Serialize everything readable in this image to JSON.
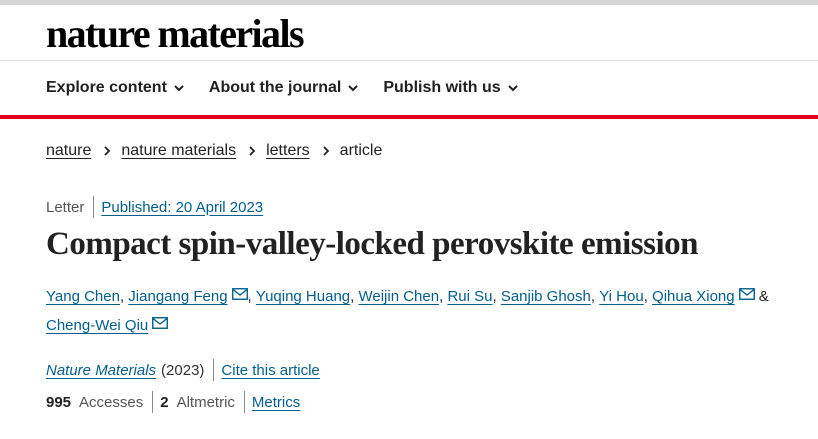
{
  "site": {
    "logo_text": "nature materials"
  },
  "nav": {
    "items": [
      {
        "label": "Explore content"
      },
      {
        "label": "About the journal"
      },
      {
        "label": "Publish with us"
      }
    ]
  },
  "breadcrumb": {
    "items": [
      "nature",
      "nature materials",
      "letters"
    ],
    "current": "article"
  },
  "article": {
    "type": "Letter",
    "published": "Published: 20 April 2023",
    "title": "Compact spin-valley-locked perovskite emission",
    "authors": [
      {
        "name": "Yang Chen",
        "email": false
      },
      {
        "name": "Jiangang Feng",
        "email": true
      },
      {
        "name": "Yuqing Huang",
        "email": false
      },
      {
        "name": "Weijin Chen",
        "email": false
      },
      {
        "name": "Rui Su",
        "email": false
      },
      {
        "name": "Sanjib Ghosh",
        "email": false
      },
      {
        "name": "Yi Hou",
        "email": false
      },
      {
        "name": "Qihua Xiong",
        "email": true
      },
      {
        "name": "Cheng-Wei Qiu",
        "email": true
      }
    ],
    "journal": "Nature Materials",
    "year": "(2023)",
    "cite_label": "Cite this article"
  },
  "metrics": {
    "accesses_value": "995",
    "accesses_label": "Accesses",
    "altmetric_value": "2",
    "altmetric_label": "Altmetric",
    "metrics_link": "Metrics"
  },
  "colors": {
    "accent_red": "#e1001a",
    "link_blue": "#025e8d",
    "text": "#222222"
  }
}
